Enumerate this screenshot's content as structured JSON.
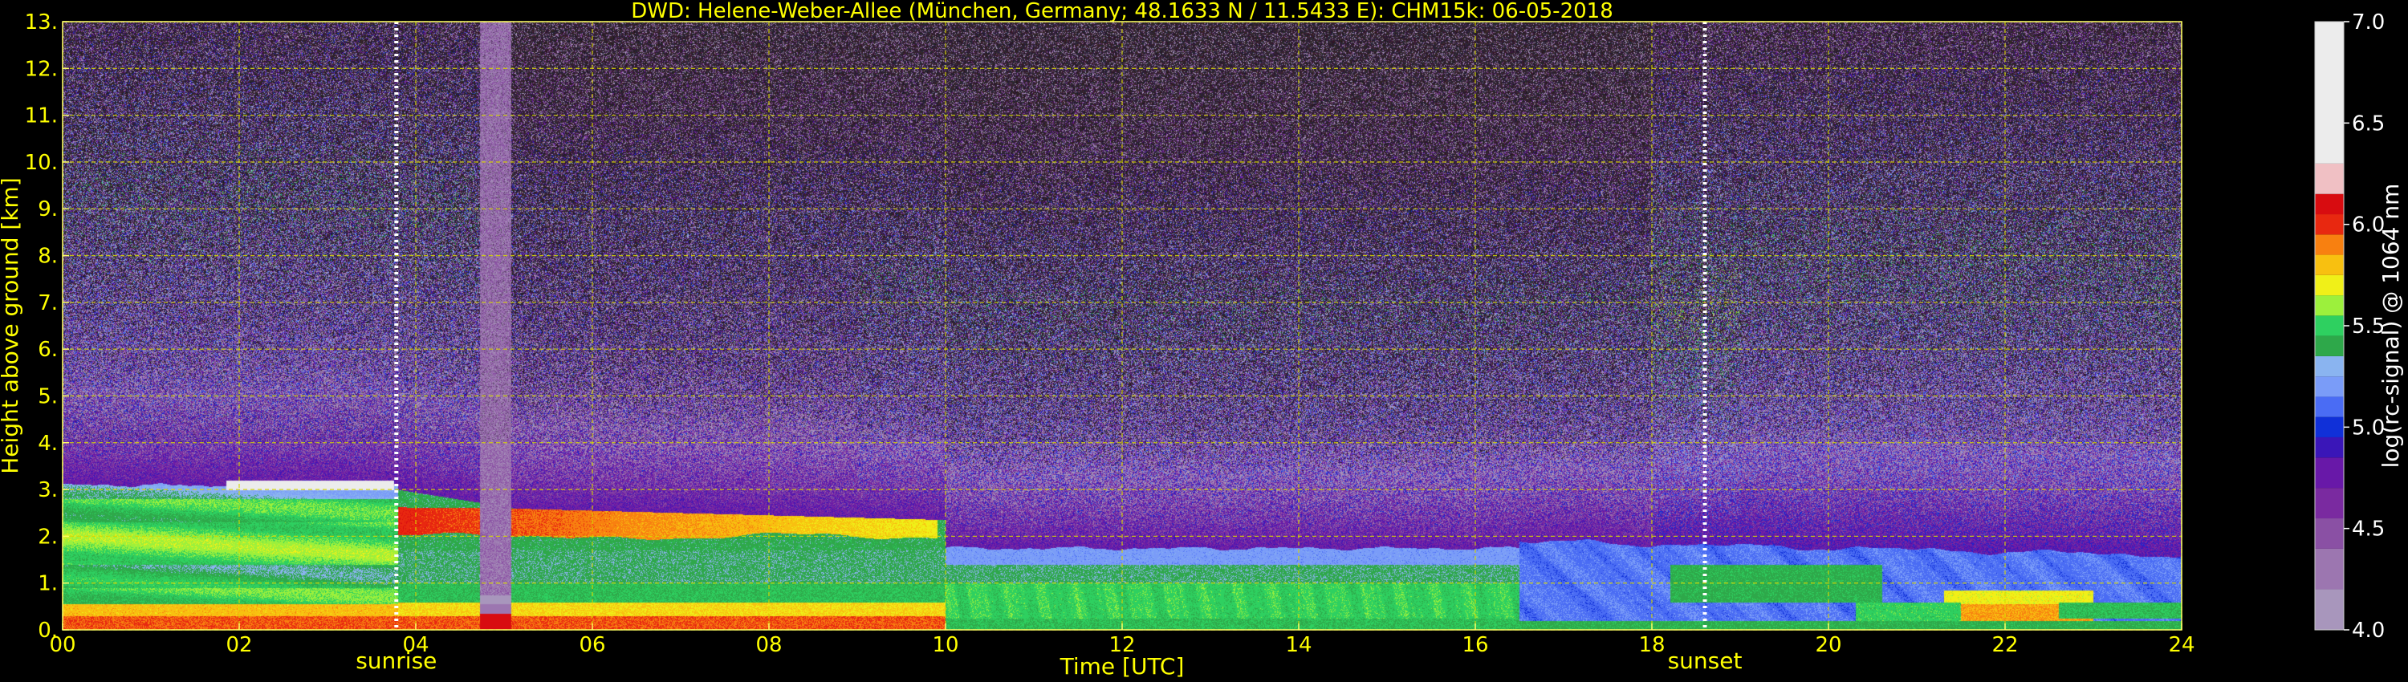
{
  "chart_data": {
    "type": "heatmap",
    "title": "DWD: Helene-Weber-Allee (München, Germany; 48.1633 N / 11.5433 E):    CHM15k: 06-05-2018",
    "xlabel": "Time [UTC]",
    "ylabel": "Height above ground [km]",
    "colorbar_label": "log(rc-signal) @ 1064 nm",
    "x_ticks": [
      "00",
      "02",
      "04",
      "06",
      "08",
      "10",
      "12",
      "14",
      "16",
      "18",
      "20",
      "22",
      "24"
    ],
    "xlim": [
      0,
      24
    ],
    "y_ticks": [
      "0.",
      "1.",
      "2.",
      "3.",
      "4.",
      "5.",
      "6.",
      "7.",
      "8.",
      "9.",
      "10.",
      "11.",
      "12.",
      "13."
    ],
    "ylim": [
      0,
      13
    ],
    "colorbar_ticks": [
      "4.0",
      "4.5",
      "5.0",
      "5.5",
      "6.0",
      "6.5",
      "7.0"
    ],
    "clim": [
      4.0,
      7.0
    ],
    "grid": true,
    "events": [
      {
        "label": "sunrise",
        "time_utc": 3.78
      },
      {
        "label": "sunset",
        "time_utc": 18.6
      }
    ],
    "colormap": [
      {
        "v": 4.0,
        "c": "#a896bc"
      },
      {
        "v": 4.2,
        "c": "#9c76b0"
      },
      {
        "v": 4.4,
        "c": "#8a50a4"
      },
      {
        "v": 4.55,
        "c": "#7a2aa0"
      },
      {
        "v": 4.7,
        "c": "#6818a8"
      },
      {
        "v": 4.85,
        "c": "#3a16b8"
      },
      {
        "v": 4.95,
        "c": "#1030d8"
      },
      {
        "v": 5.05,
        "c": "#4a6cf4"
      },
      {
        "v": 5.15,
        "c": "#7a9cf8"
      },
      {
        "v": 5.25,
        "c": "#8ab4f0"
      },
      {
        "v": 5.35,
        "c": "#2ea84a"
      },
      {
        "v": 5.45,
        "c": "#2ed060"
      },
      {
        "v": 5.55,
        "c": "#9cf03c"
      },
      {
        "v": 5.65,
        "c": "#f0f018"
      },
      {
        "v": 5.75,
        "c": "#f8c010"
      },
      {
        "v": 5.85,
        "c": "#f88010"
      },
      {
        "v": 5.95,
        "c": "#e82810"
      },
      {
        "v": 6.05,
        "c": "#d80c10"
      },
      {
        "v": 6.15,
        "c": "#f0c0c4"
      },
      {
        "v": 6.3,
        "c": "#ececec"
      },
      {
        "v": 7.0,
        "c": "#ffffff"
      }
    ],
    "field_description": {
      "noise_above_layer": "high",
      "regions": [
        {
          "name": "residual_layer",
          "t": [
            0,
            3.8
          ],
          "z": [
            0.6,
            3.1
          ],
          "value": 5.5
        },
        {
          "name": "night_aerosol_top_cloud",
          "t": [
            1.8,
            3.8
          ],
          "z": [
            3.0,
            3.2
          ],
          "value": 6.8
        },
        {
          "name": "precip_column",
          "t": [
            4.7,
            5.1
          ],
          "z": [
            0.6,
            13
          ],
          "value": 4.3
        },
        {
          "name": "elevated_red_layer",
          "t": [
            5.1,
            10.0
          ],
          "z": [
            2.0,
            2.6
          ],
          "value": 6.0
        },
        {
          "name": "boundary_layer_green",
          "t": [
            0,
            16.5
          ],
          "z": [
            0.1,
            1.8
          ],
          "value": 5.45
        },
        {
          "name": "evening_blue",
          "t": [
            16.5,
            24
          ],
          "z": [
            0.2,
            1.9
          ],
          "value": 5.1
        },
        {
          "name": "evening_orange",
          "t": [
            21.3,
            23.0
          ],
          "z": [
            0.2,
            0.9
          ],
          "value": 5.8
        }
      ]
    }
  }
}
